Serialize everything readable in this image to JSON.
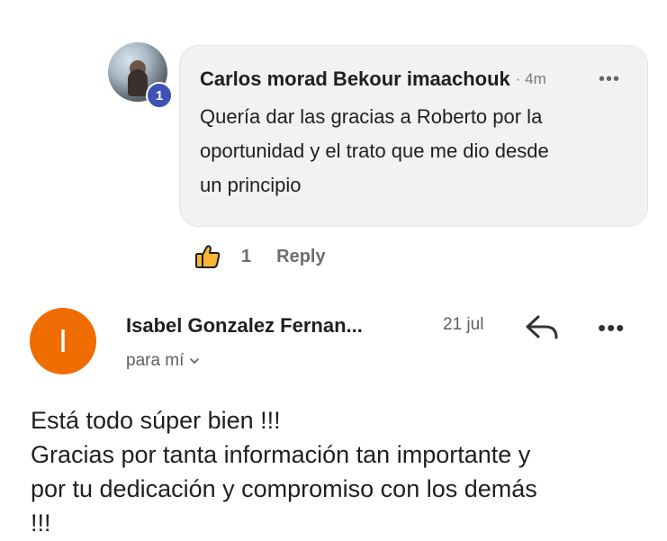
{
  "comment": {
    "avatar_badge": "1",
    "author": "Carlos morad Bekour imaachouk",
    "time": "· 4m",
    "more_label": "•••",
    "lines": [
      "Quería dar las gracias a Roberto por la",
      "oportunidad y el trato que me dio desde",
      "un principio"
    ],
    "like_count": "1",
    "reply_label": "Reply"
  },
  "email": {
    "avatar_letter": "I",
    "avatar_color": "#ef6c00",
    "sender": "Isabel Gonzalez Fernan...",
    "date": "21 jul",
    "recipient": "para mí",
    "more_label": "•••",
    "body_lines": [
      "Está todo súper bien !!!",
      "Gracias por tanta información tan importante y",
      "por tu dedicación y compromiso con los demás",
      "!!!"
    ]
  },
  "icons": {
    "like": "thumbs-up-icon",
    "reply": "reply-arrow-icon",
    "more": "more-horizontal-icon",
    "chevron": "chevron-down-icon"
  }
}
